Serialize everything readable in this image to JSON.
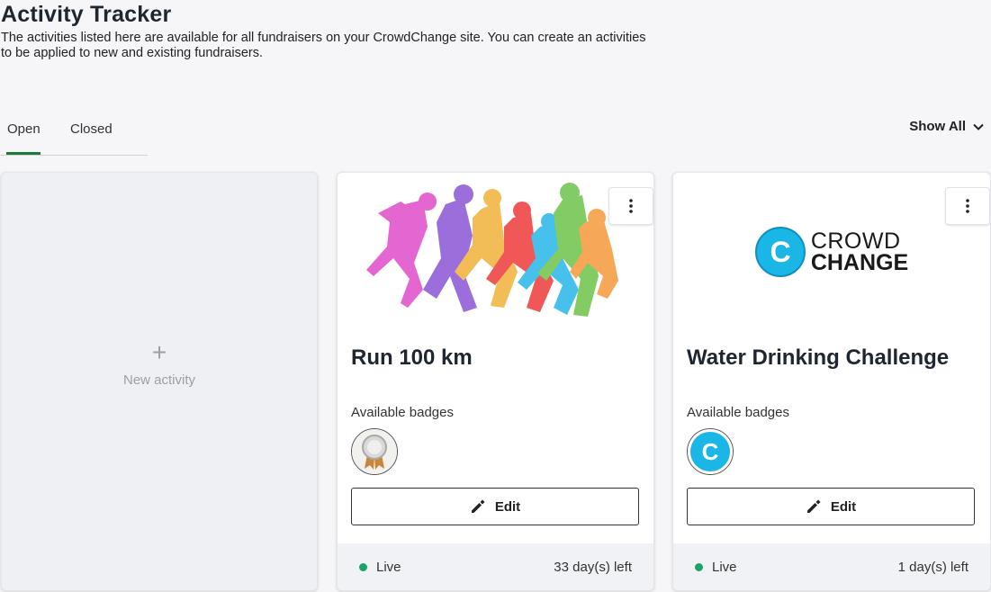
{
  "page": {
    "title": "Activity Tracker",
    "description": "The activities listed here are available for all fundraisers on your CrowdChange site. You can create an activities to be applied to new and existing fundraisers."
  },
  "tabs": [
    {
      "label": "Open",
      "active": true
    },
    {
      "label": "Closed",
      "active": false
    }
  ],
  "filter": {
    "label": "Show All",
    "icon": "chevron-down-icon"
  },
  "new_activity": {
    "icon": "plus-icon",
    "label": "New activity"
  },
  "colors": {
    "accent": "#1d7a3a",
    "live": "#1aa36b",
    "crowdchange_blue": "#19b6e6"
  },
  "activities": [
    {
      "title": "Run 100 km",
      "badges_label": "Available badges",
      "badge_icon": "medal-icon",
      "edit_label": "Edit",
      "status": "Live",
      "days_left": "33 day(s) left"
    },
    {
      "title": "Water Drinking Challenge",
      "logo": {
        "line1": "CROWD",
        "line2": "CHANGE",
        "mark": "C"
      },
      "badges_label": "Available badges",
      "badge_icon": "crowdchange-c-icon",
      "edit_label": "Edit",
      "status": "Live",
      "days_left": "1 day(s) left"
    }
  ]
}
